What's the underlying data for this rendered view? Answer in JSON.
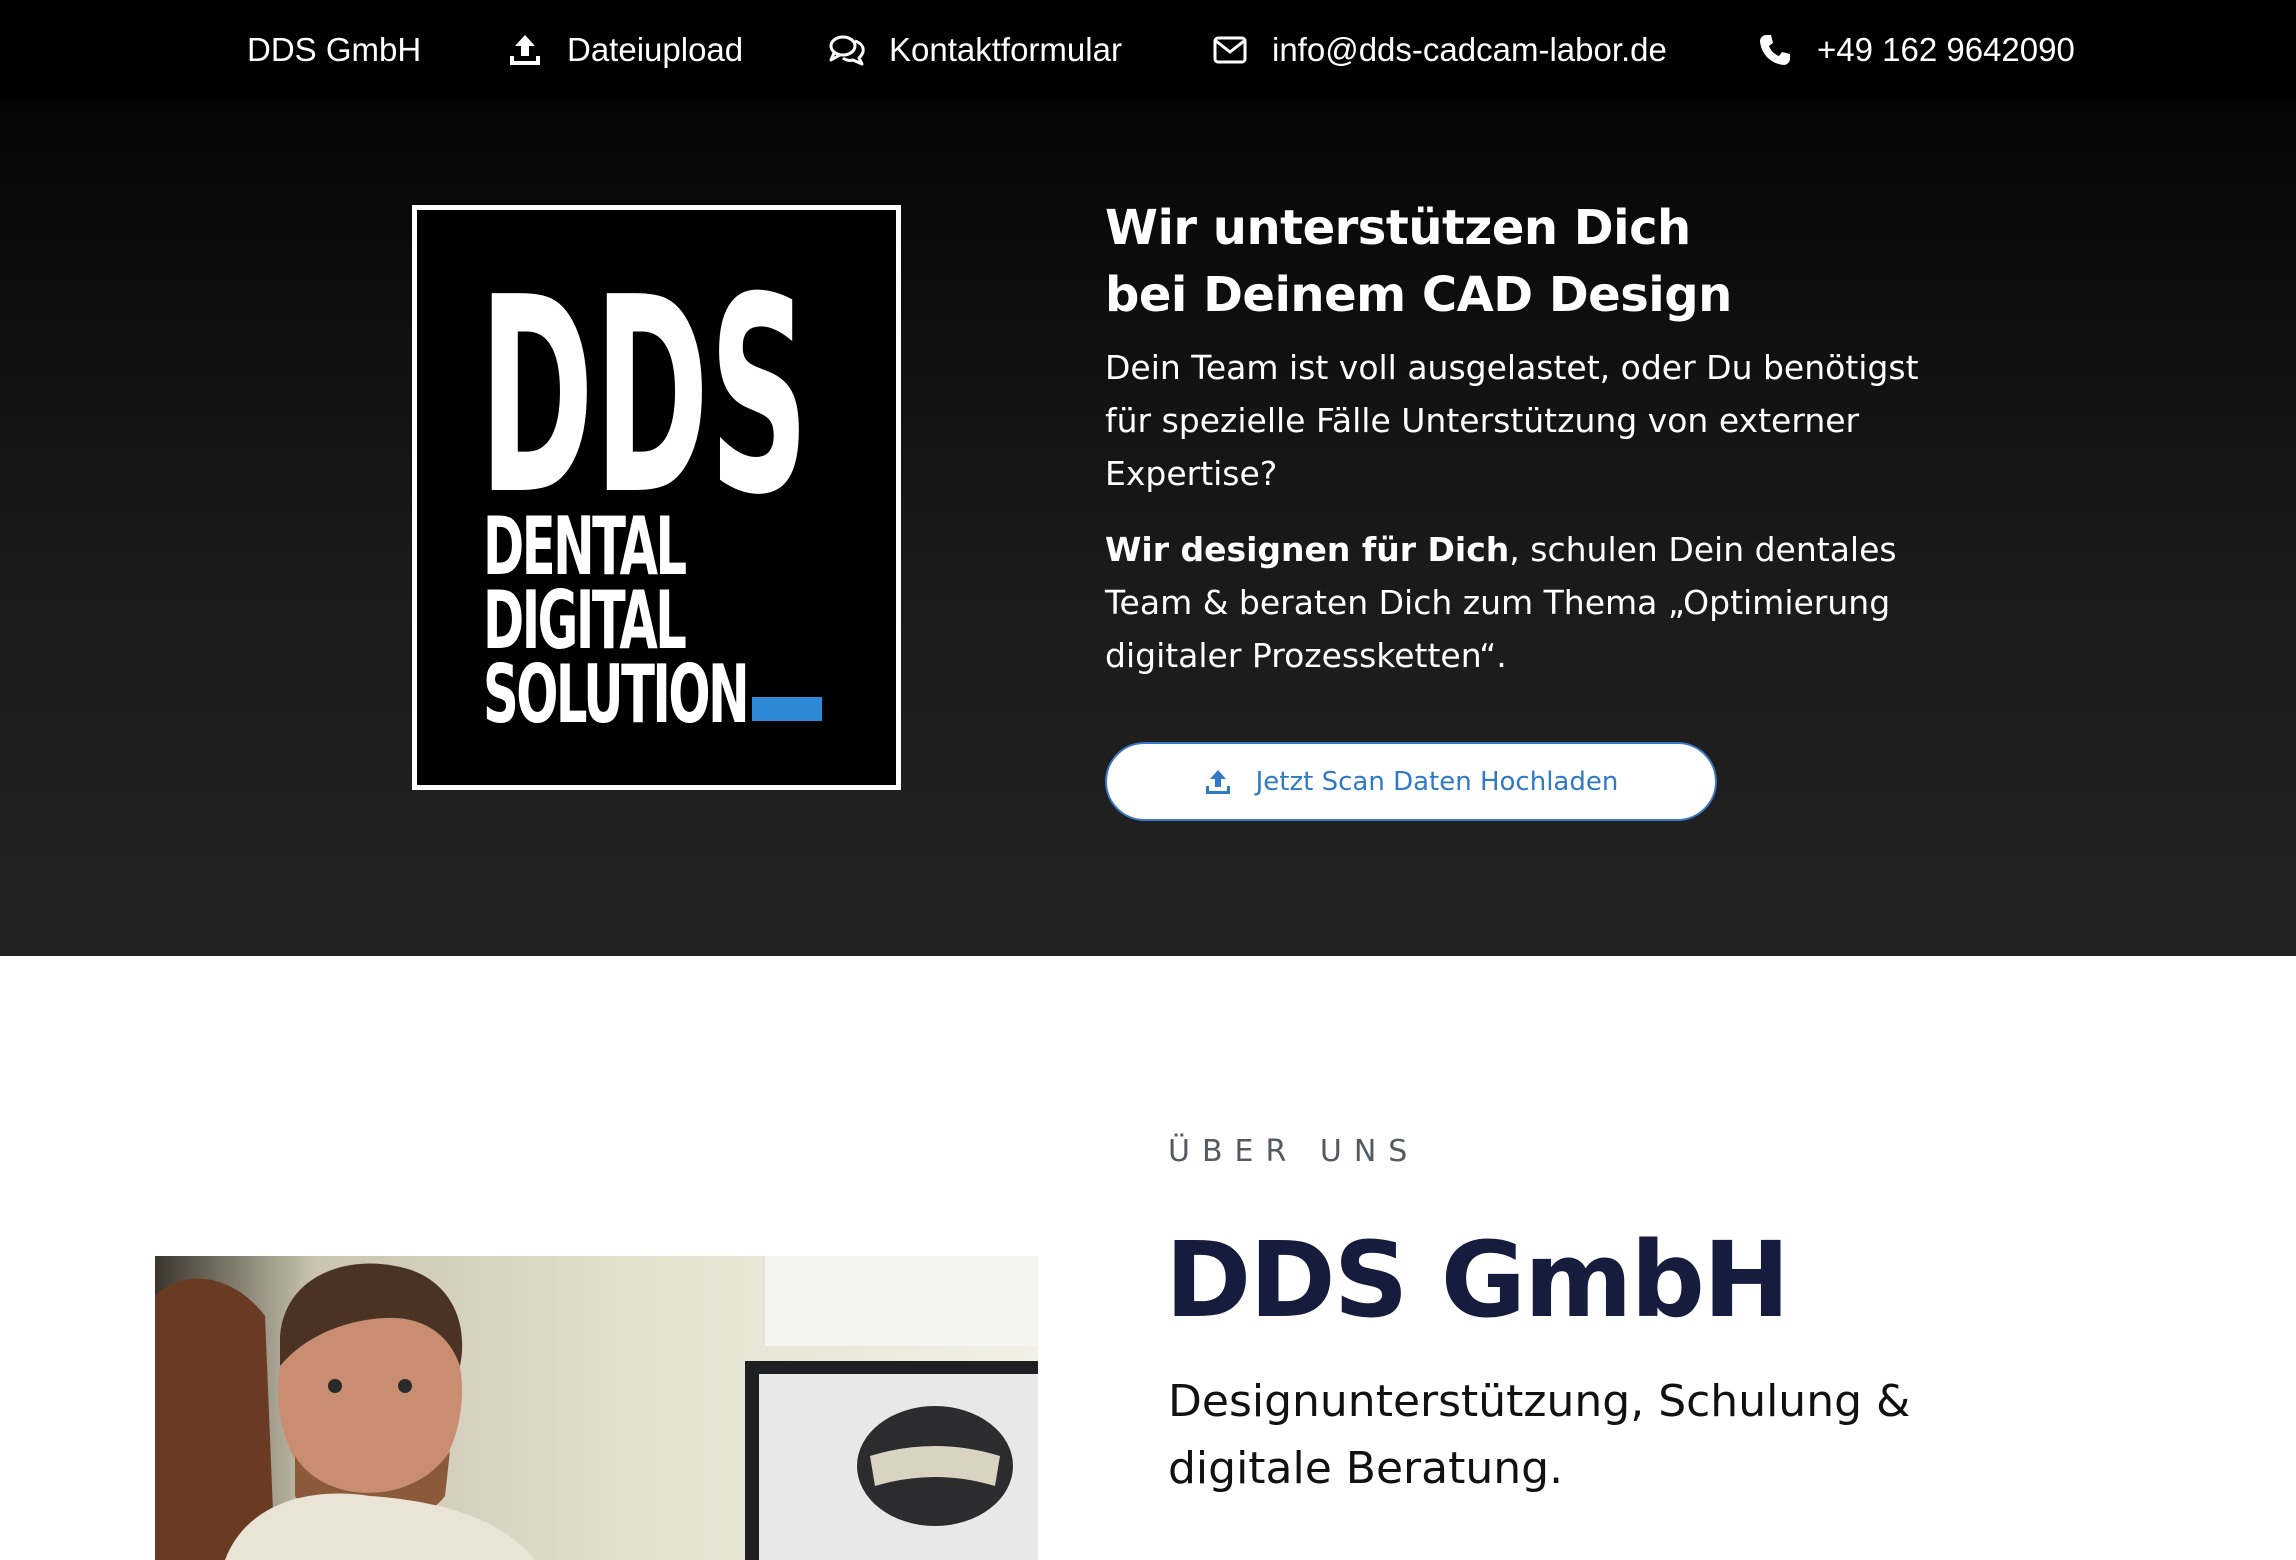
{
  "topbar": {
    "brand": "DDS GmbH",
    "upload_label": "Dateiupload",
    "contact_label": "Kontaktformular",
    "email": "info@dds-cadcam-labor.de",
    "phone": "+49 162 9642090",
    "icons": {
      "upload": "upload-icon",
      "contact": "chat-bubbles-icon",
      "email": "envelope-icon",
      "phone": "phone-icon"
    }
  },
  "hero": {
    "logo": {
      "big": "DDS",
      "line1": "DENTAL",
      "line2": "DIGITAL",
      "line3": "SOLUTION",
      "accent_color": "#2e8ad6"
    },
    "title_line1": "Wir unterstützen Dich",
    "title_line2": "bei Deinem CAD Design",
    "paragraph1": "Dein Team ist voll ausgelastet, oder Du benötigst für spezielle Fälle Unterstützung von externer Expertise?",
    "paragraph2_bold": "Wir designen für Dich",
    "paragraph2_rest": ", schulen Dein dentales Team & beraten Dich zum Thema „Optimierung digitaler Prozessketten“.",
    "cta_label": "Jetzt Scan Daten Hochladen",
    "cta_color": "#2f7ac8"
  },
  "about": {
    "eyebrow": "ÜBER UNS",
    "title": "DDS GmbH",
    "subtitle": "Designunterstützung, Schulung & digitale Beratung.",
    "title_color": "#151c3d"
  }
}
